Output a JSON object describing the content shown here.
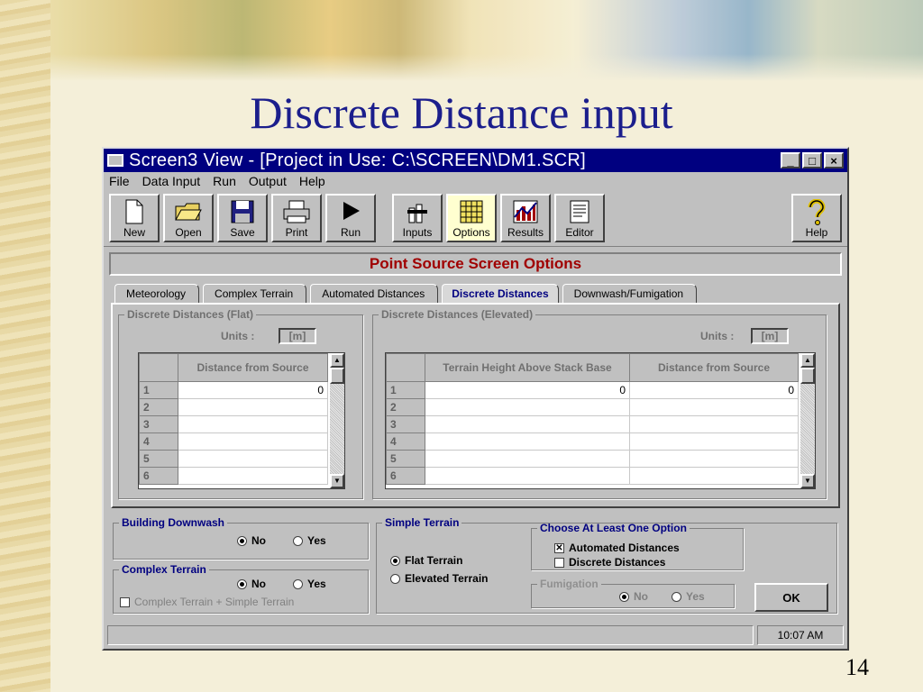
{
  "slide": {
    "title": "Discrete Distance input",
    "page_number": "14"
  },
  "window": {
    "title": "Screen3 View - [Project in Use: C:\\SCREEN\\DM1.SCR]",
    "controls": [
      "_",
      "□",
      "×"
    ]
  },
  "menu": [
    "File",
    "Data Input",
    "Run",
    "Output",
    "Help"
  ],
  "toolbar": {
    "buttons": [
      {
        "label": "New",
        "icon": "new-document-icon"
      },
      {
        "label": "Open",
        "icon": "open-folder-icon"
      },
      {
        "label": "Save",
        "icon": "floppy-disk-icon"
      },
      {
        "label": "Print",
        "icon": "printer-icon"
      },
      {
        "label": "Run",
        "icon": "play-arrow-icon"
      },
      {
        "label": "Inputs",
        "icon": "stack-icon"
      },
      {
        "label": "Options",
        "icon": "grid-icon",
        "active": true
      },
      {
        "label": "Results",
        "icon": "bar-chart-icon"
      },
      {
        "label": "Editor",
        "icon": "text-document-icon"
      },
      {
        "label": "Help",
        "icon": "question-mark-icon"
      }
    ]
  },
  "panel": {
    "title": "Point Source Screen Options",
    "tabs": [
      "Meteorology",
      "Complex Terrain",
      "Automated Distances",
      "Discrete Distances",
      "Downwash/Fumigation"
    ],
    "selected_tab": "Discrete Distances"
  },
  "flat": {
    "group_label": "Discrete Distances (Flat)",
    "units_label": "Units :",
    "units_value": "[m]",
    "column_header": "Distance from Source",
    "rows": [
      "1",
      "2",
      "3",
      "4",
      "5",
      "6"
    ],
    "first_value": "0"
  },
  "elevated": {
    "group_label": "Discrete Distances (Elevated)",
    "units_label": "Units :",
    "units_value": "[m]",
    "col1_header": "Terrain Height Above Stack Base",
    "col2_header": "Distance from Source",
    "rows": [
      "1",
      "2",
      "3",
      "4",
      "5",
      "6"
    ],
    "first_values": [
      "0",
      "0"
    ]
  },
  "building_downwash": {
    "label": "Building Downwash",
    "options": [
      "No",
      "Yes"
    ],
    "selected": "No"
  },
  "complex_terrain": {
    "label": "Complex Terrain",
    "options": [
      "No",
      "Yes"
    ],
    "selected": "No",
    "checkbox_label": "Complex Terrain + Simple Terrain",
    "checkbox_checked": false
  },
  "simple_terrain": {
    "label": "Simple Terrain",
    "options": [
      "Flat Terrain",
      "Elevated Terrain"
    ],
    "selected": "Flat Terrain"
  },
  "choose_option": {
    "label": "Choose At Least One Option",
    "automated": "Automated Distances",
    "automated_checked": true,
    "discrete": "Discrete Distances",
    "discrete_checked": false
  },
  "fumigation": {
    "label": "Fumigation",
    "options": [
      "No",
      "Yes"
    ],
    "selected": "No"
  },
  "ok_label": "OK",
  "status": {
    "message": "",
    "clock": "10:07 AM"
  }
}
